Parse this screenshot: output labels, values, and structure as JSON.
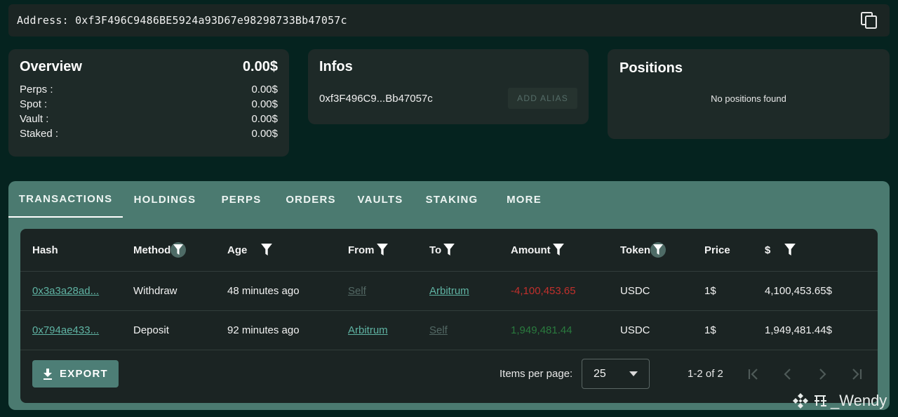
{
  "address": {
    "label": "Address: 0xf3F496C9486BE5924a93D67e98298733Bb47057c",
    "copy_icon": "copy-icon"
  },
  "overview": {
    "title": "Overview",
    "total": "0.00$",
    "rows": [
      {
        "label": "Perps :",
        "value": "0.00$"
      },
      {
        "label": "Spot :",
        "value": "0.00$"
      },
      {
        "label": "Vault :",
        "value": "0.00$"
      },
      {
        "label": "Staked :",
        "value": "0.00$"
      }
    ]
  },
  "infos": {
    "title": "Infos",
    "address_short": "0xf3F496C9...Bb47057c",
    "alias_button": "ADD ALIAS"
  },
  "positions": {
    "title": "Positions",
    "empty_text": "No positions found"
  },
  "tabs": [
    "TRANSACTIONS",
    "HOLDINGS",
    "PERPS",
    "ORDERS",
    "VAULTS",
    "STAKING",
    "MORE"
  ],
  "table": {
    "headers": [
      "Hash",
      "Method",
      "Age",
      "From",
      "To",
      "Amount",
      "Token",
      "Price",
      "$"
    ],
    "rows": [
      {
        "hash": "0x3a3a28ad...",
        "method": "Withdraw",
        "age": "48 minutes ago",
        "from": "Self",
        "to": "Arbitrum",
        "amount": "-4,100,453.65",
        "token": "USDC",
        "price": "1$",
        "usd": "4,100,453.65$"
      },
      {
        "hash": "0x794ae433...",
        "method": "Deposit",
        "age": "92 minutes ago",
        "from": "Arbitrum",
        "to": "Self",
        "amount": "1,949,481.44",
        "token": "USDC",
        "price": "1$",
        "usd": "1,949,481.44$"
      }
    ]
  },
  "footer": {
    "export_label": "EXPORT",
    "items_per_page_label": "Items per page:",
    "items_per_page_value": "25",
    "range_text": "1-2 of 2"
  },
  "watermark": "_Wendy",
  "colors": {
    "background": "#05231f",
    "card": "#1e2a28",
    "tabs_bg": "#4b7a70",
    "link": "#5fb3a3",
    "negative": "#c0302c",
    "positive": "#2a7a3e"
  }
}
